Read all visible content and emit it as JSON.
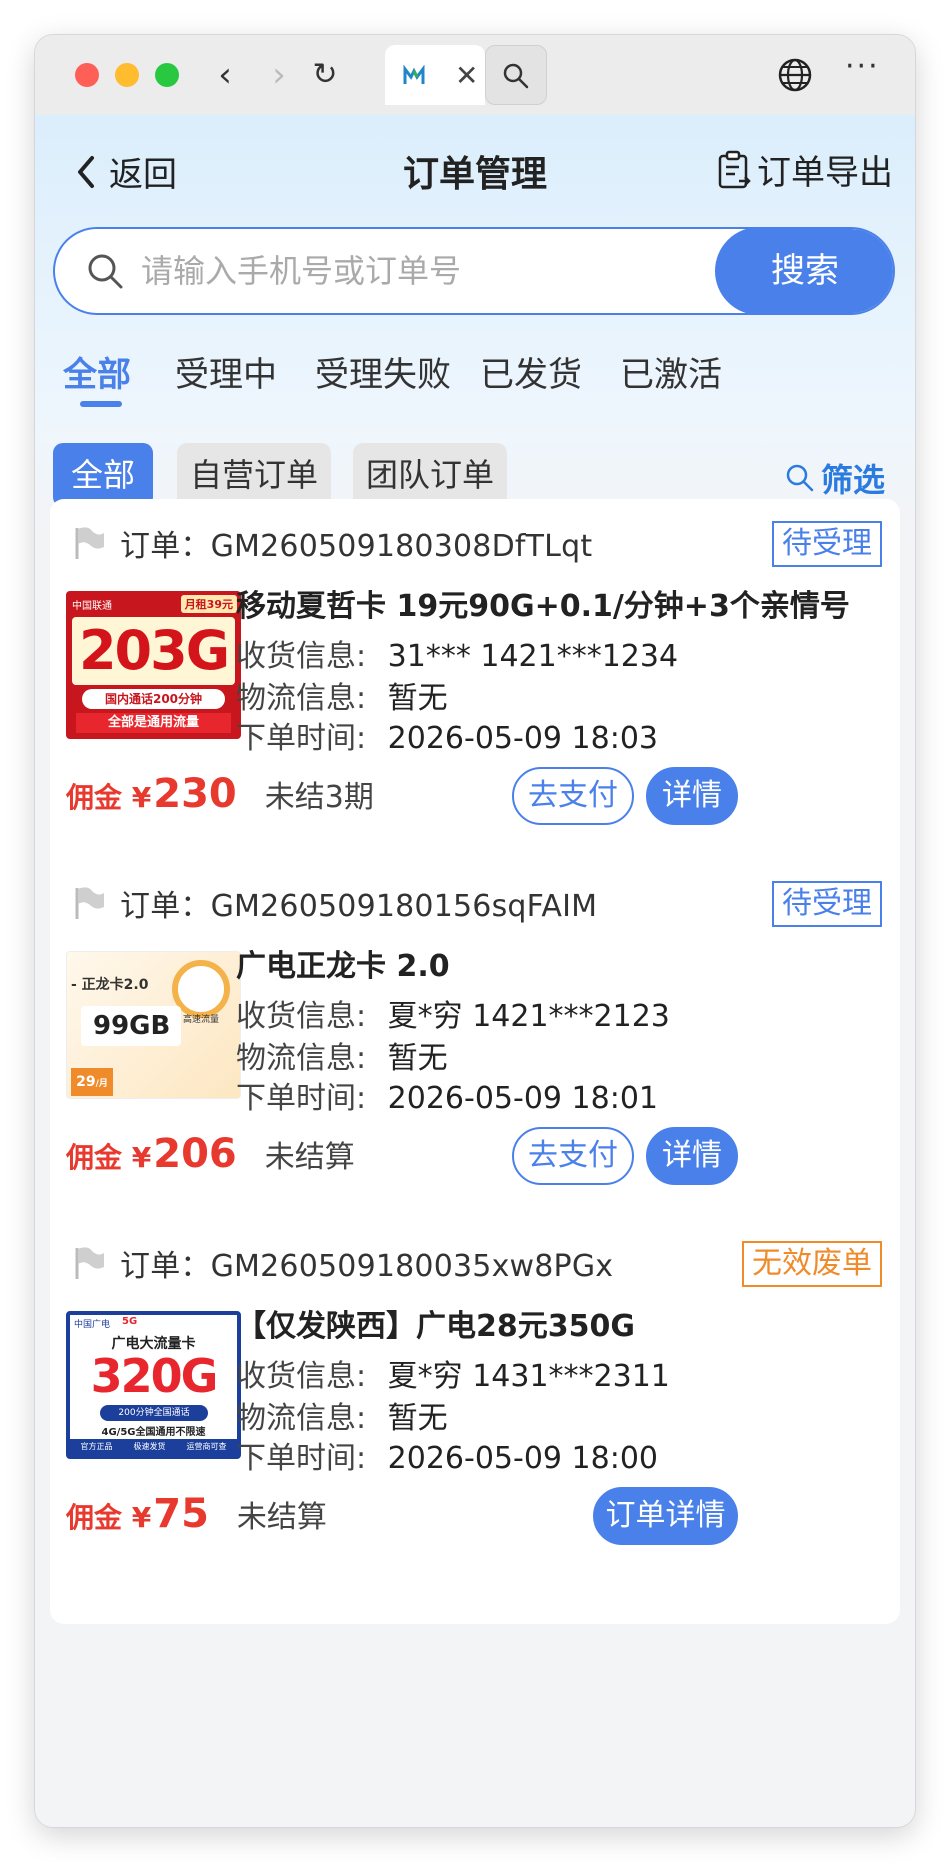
{
  "browser": {
    "tab_close": "✕",
    "more": "···",
    "back_glyph": "‹",
    "forward_glyph": "›",
    "reload_glyph": "↻"
  },
  "header": {
    "back_label": "返回",
    "title": "订单管理",
    "export_label": "订单导出"
  },
  "search": {
    "placeholder": "请输入手机号或订单号",
    "button_label": "搜索"
  },
  "status_tabs": [
    {
      "label": "全部",
      "active": true
    },
    {
      "label": "受理中",
      "active": false
    },
    {
      "label": "受理失败",
      "active": false
    },
    {
      "label": "已发货",
      "active": false
    },
    {
      "label": "已激活",
      "active": false
    }
  ],
  "chips": [
    {
      "label": "全部",
      "active": true
    },
    {
      "label": "自营订单",
      "active": false
    },
    {
      "label": "团队订单",
      "active": false
    }
  ],
  "filter_label": "筛选",
  "colors": {
    "accent": "#4a80ea",
    "danger": "#e8392f",
    "warning": "#f08b2c"
  },
  "orders": [
    {
      "order_no": "订单：GM260509180308DfTLqt",
      "status": "待受理",
      "product": "移动夏哲卡 19元90G+0.1/分钟+3个亲情号",
      "shipping_label": "收货信息:",
      "shipping_value": "31***   1421***1234",
      "logistics_label": "物流信息:",
      "logistics_value": "暂无",
      "time_label": "下单时间:",
      "time_value": "2026-05-09 18:03",
      "commission_label": "佣金 ¥",
      "commission_value": "230",
      "settle": "未结3期",
      "pay_label": "去支付",
      "detail_label": "详情",
      "thumb": {
        "brand": "中国联通",
        "tag": "月租39元",
        "big": "203G",
        "line1": "国内通话200分钟",
        "line2": "全部是通用流量"
      }
    },
    {
      "order_no": "订单：GM260509180156sqFAIM",
      "status": "待受理",
      "product": "广电正龙卡 2.0",
      "shipping_label": "收货信息:",
      "shipping_value": "夏*穷   1421***2123",
      "logistics_label": "物流信息:",
      "logistics_value": "暂无",
      "time_label": "下单时间:",
      "time_value": "2026-05-09 18:01",
      "commission_label": "佣金 ¥",
      "commission_value": "206",
      "settle": "未结算",
      "pay_label": "去支付",
      "detail_label": "详情",
      "thumb": {
        "title": "- 正龙卡2.0",
        "big": "99GB",
        "small": "高速流量",
        "price": "29",
        "price_unit": "/月"
      }
    },
    {
      "order_no": "订单：GM260509180035xw8PGx",
      "status": "无效废单",
      "product": "【仅发陕西】广电28元350G",
      "shipping_label": "收货信息:",
      "shipping_value": "夏*穷   1431***2311",
      "logistics_label": "物流信息:",
      "logistics_value": "暂无",
      "time_label": "下单时间:",
      "time_value": "2026-05-09 18:00",
      "commission_label": "佣金 ¥",
      "commission_value": "75",
      "settle": "未结算",
      "detail_label": "订单详情",
      "thumb": {
        "brand": "中国广电",
        "net": "5G",
        "title": "广电大流量卡",
        "big": "320G",
        "line1": "200分钟全国通话",
        "line2": "4G/5G全国通用不限速",
        "f1": "官方正品",
        "f2": "极速发货",
        "f3": "运营商可查"
      }
    }
  ]
}
